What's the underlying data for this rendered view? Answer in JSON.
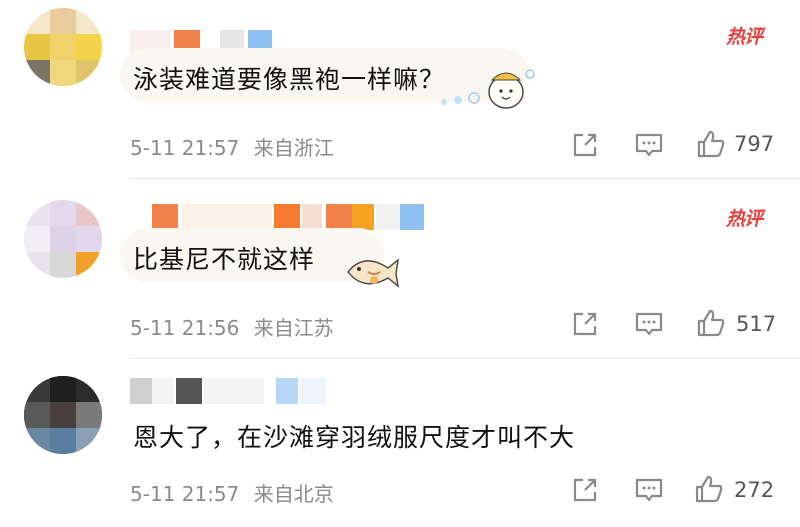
{
  "comments": [
    {
      "text": "泳装难道要像黑袍一样嘛？",
      "badge": "热评",
      "time": "5-11 21:57",
      "location": "来自浙江",
      "likes": "797",
      "sticker": "emoji-sticker-icon"
    },
    {
      "text": "比基尼不就这样",
      "badge": "热评",
      "time": "5-11 21:56",
      "location": "来自江苏",
      "likes": "517",
      "sticker": "fish-sticker-icon"
    },
    {
      "text": "恩大了，在沙滩穿羽绒服尺度才叫不大",
      "time": "5-11 21:57",
      "location": "来自北京",
      "likes": "272"
    }
  ],
  "colors": {
    "hot_badge": "#e8413d",
    "meta_text": "#8a8a8a",
    "bubble_bg": "#faf7f0"
  }
}
